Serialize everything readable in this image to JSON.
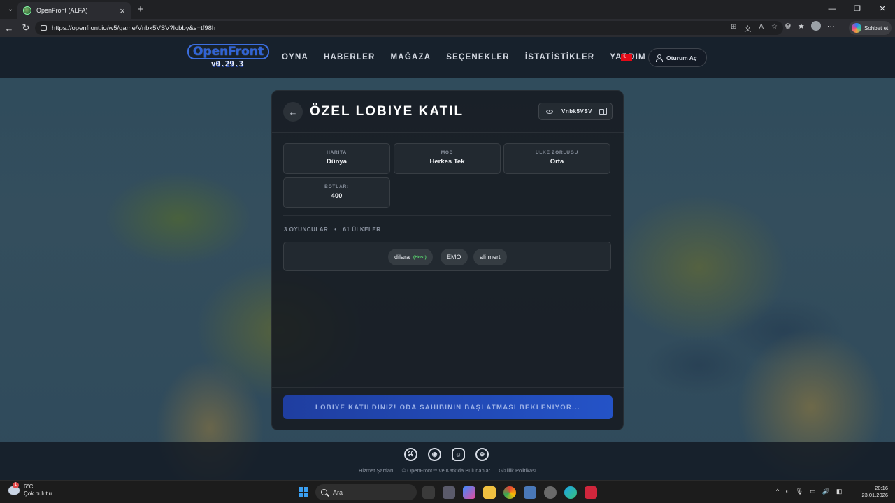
{
  "browser": {
    "tab_title": "OpenFront (ALFA)",
    "url": "https://openfront.io/w5/game/Vnbk5VSV?lobby&s=tf98h",
    "copilot_label": "Sohbet et"
  },
  "header": {
    "logo_text": "OpenFront",
    "version": "v0.29.3",
    "nav": [
      "OYNA",
      "HABERLER",
      "MAĞAZA",
      "SEÇENEKLER",
      "İSTATİSTİKLER",
      "YARDIM"
    ],
    "signin_label": "Oturum Aç"
  },
  "lobby": {
    "title": "ÖZEL LOBIYE KATIL",
    "code": "Vnbk5VSV",
    "settings": [
      {
        "label": "HARITA",
        "value": "Dünya"
      },
      {
        "label": "MOD",
        "value": "Herkes Tek"
      },
      {
        "label": "ÜLKE ZORLUĞU",
        "value": "Orta"
      },
      {
        "label": "BOTLAR:",
        "value": "400"
      }
    ],
    "players_count": "3 OYUNCULAR",
    "countries_count": "61 ÜLKELER",
    "separator": "•",
    "players": [
      {
        "name": "dilara",
        "tag": "(Host)"
      },
      {
        "name": "EMO",
        "tag": ""
      },
      {
        "name": "ali mert",
        "tag": ""
      }
    ],
    "wait_label": "LOBIYE KATILDINIZ! ODA SAHIBININ BAŞLATMASI BEKLENIYOR..."
  },
  "footer": {
    "links": [
      "Hizmet Şartları",
      "© OpenFront™ ve Katkıda Bulunanlar",
      "Gizlilik Politikası"
    ]
  },
  "taskbar": {
    "temperature": "6°C",
    "weather_desc": "Çok bulutlu",
    "search_placeholder": "Ara",
    "time": "20:16",
    "date": "23.01.2026"
  }
}
